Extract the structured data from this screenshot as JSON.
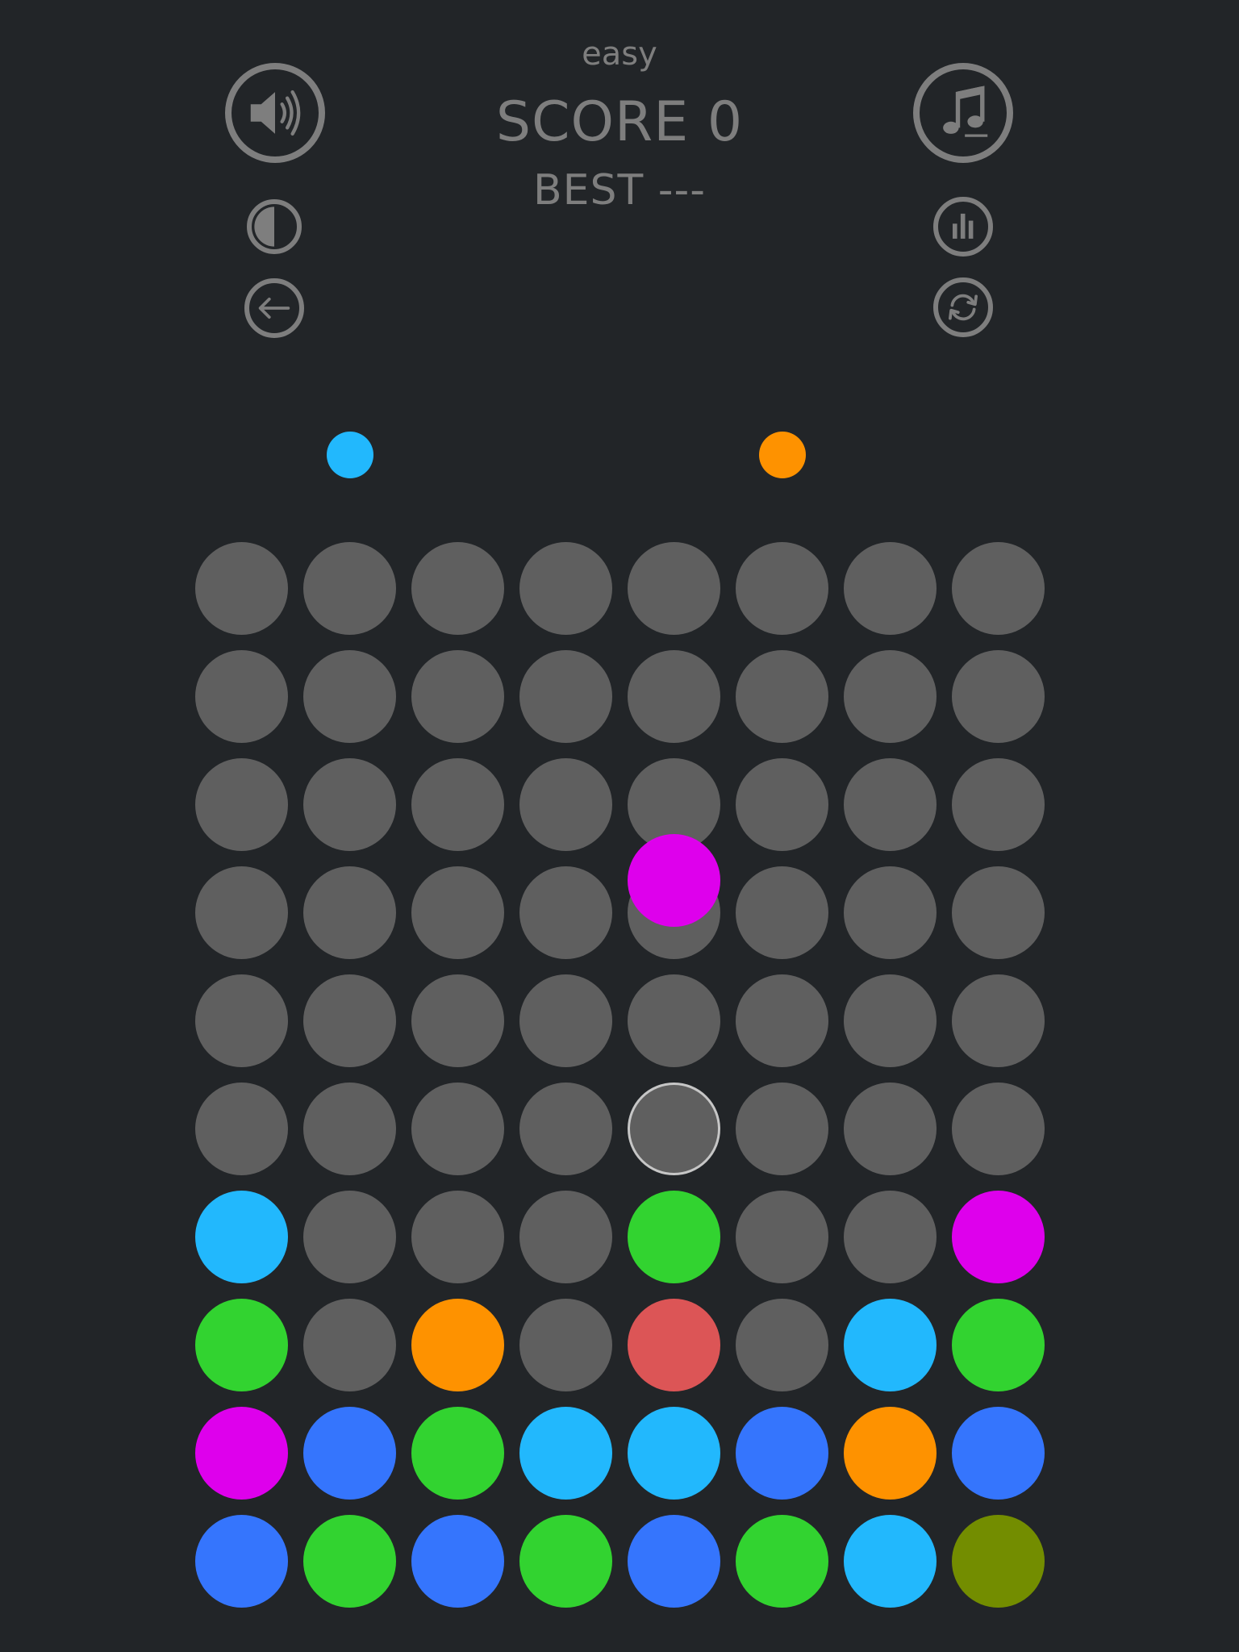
{
  "header": {
    "difficulty": "easy",
    "score_text": "SCORE 0",
    "best_text": "BEST ---"
  },
  "buttons": {
    "sound": "speaker-icon",
    "music": "music-note-icon",
    "contrast": "contrast-icon",
    "back": "arrow-left-icon",
    "stats": "bar-chart-icon",
    "restart": "refresh-icon"
  },
  "colors": {
    "background": "#222528",
    "empty": "#5f5f5f",
    "ui": "#7e7e7e",
    "cyan": "#22b8fd",
    "blue": "#3575fd",
    "green": "#32d330",
    "orange": "#fe9200",
    "magenta": "#de00ec",
    "red": "#dc5556",
    "olive": "#738d00"
  },
  "board": {
    "columns": 8,
    "rows": 10,
    "selected_cell": {
      "row": 5,
      "col": 4
    },
    "moving_ball": "magenta",
    "cells": [
      [
        null,
        null,
        null,
        null,
        null,
        null,
        null,
        null
      ],
      [
        null,
        null,
        null,
        null,
        null,
        null,
        null,
        null
      ],
      [
        null,
        null,
        null,
        null,
        null,
        null,
        null,
        null
      ],
      [
        null,
        null,
        null,
        null,
        null,
        null,
        null,
        null
      ],
      [
        null,
        null,
        null,
        null,
        null,
        null,
        null,
        null
      ],
      [
        null,
        null,
        null,
        null,
        null,
        null,
        null,
        null
      ],
      [
        "cyan",
        null,
        null,
        null,
        "green",
        null,
        null,
        "magenta"
      ],
      [
        "green",
        null,
        "orange",
        null,
        "red",
        null,
        "cyan",
        "green"
      ],
      [
        "magenta",
        "blue",
        "green",
        "cyan",
        "cyan",
        "blue",
        "orange",
        "blue"
      ],
      [
        "blue",
        "green",
        "blue",
        "green",
        "blue",
        "green",
        "cyan",
        "olive"
      ]
    ]
  },
  "next_balls": [
    {
      "column": 1,
      "color": "cyan"
    },
    {
      "column": 5,
      "color": "orange"
    }
  ]
}
